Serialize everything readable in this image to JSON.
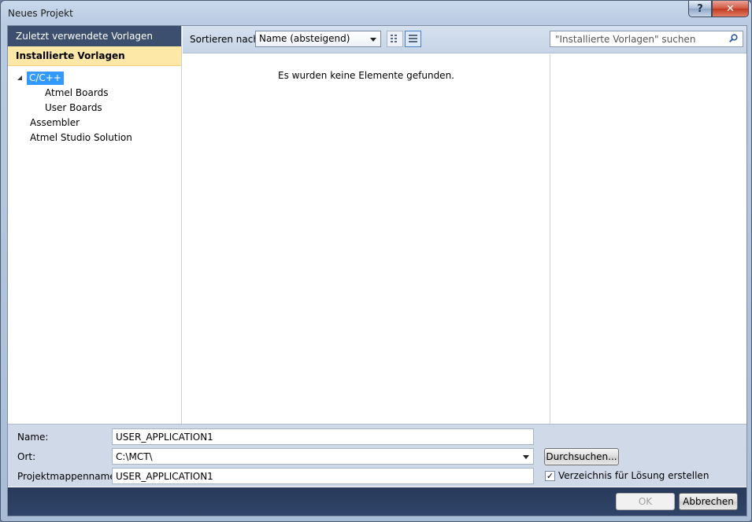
{
  "window": {
    "title": "Neues Projekt",
    "help_label": "?",
    "close_label": "✕"
  },
  "left": {
    "recent_header": "Zuletzt verwendete Vorlagen",
    "installed_header": "Installierte Vorlagen",
    "tree": {
      "cpp": "C/C++",
      "atmel_boards": "Atmel Boards",
      "user_boards": "User Boards",
      "assembler": "Assembler",
      "solution": "Atmel Studio Solution"
    }
  },
  "toolbar": {
    "sort_label": "Sortieren nach:",
    "sort_value": "Name (absteigend)",
    "search_placeholder": "\"Installierte Vorlagen\" suchen"
  },
  "center": {
    "empty_message": "Es wurden keine Elemente gefunden."
  },
  "form": {
    "name_label": "Name:",
    "name_value": "USER_APPLICATION1",
    "location_label": "Ort:",
    "location_value": "C:\\MCT\\",
    "browse_label": "Durchsuchen...",
    "solution_label": "Projektmappenname:",
    "solution_value": "USER_APPLICATION1",
    "create_dir_label": "Verzeichnis für Lösung erstellen",
    "create_dir_checked": "✓"
  },
  "footer": {
    "ok_label": "OK",
    "cancel_label": "Abbrechen"
  },
  "colors": {
    "selection": "#3399ff",
    "header_dark": "#3d4f6e",
    "installed_bg": "#fde8a8"
  }
}
